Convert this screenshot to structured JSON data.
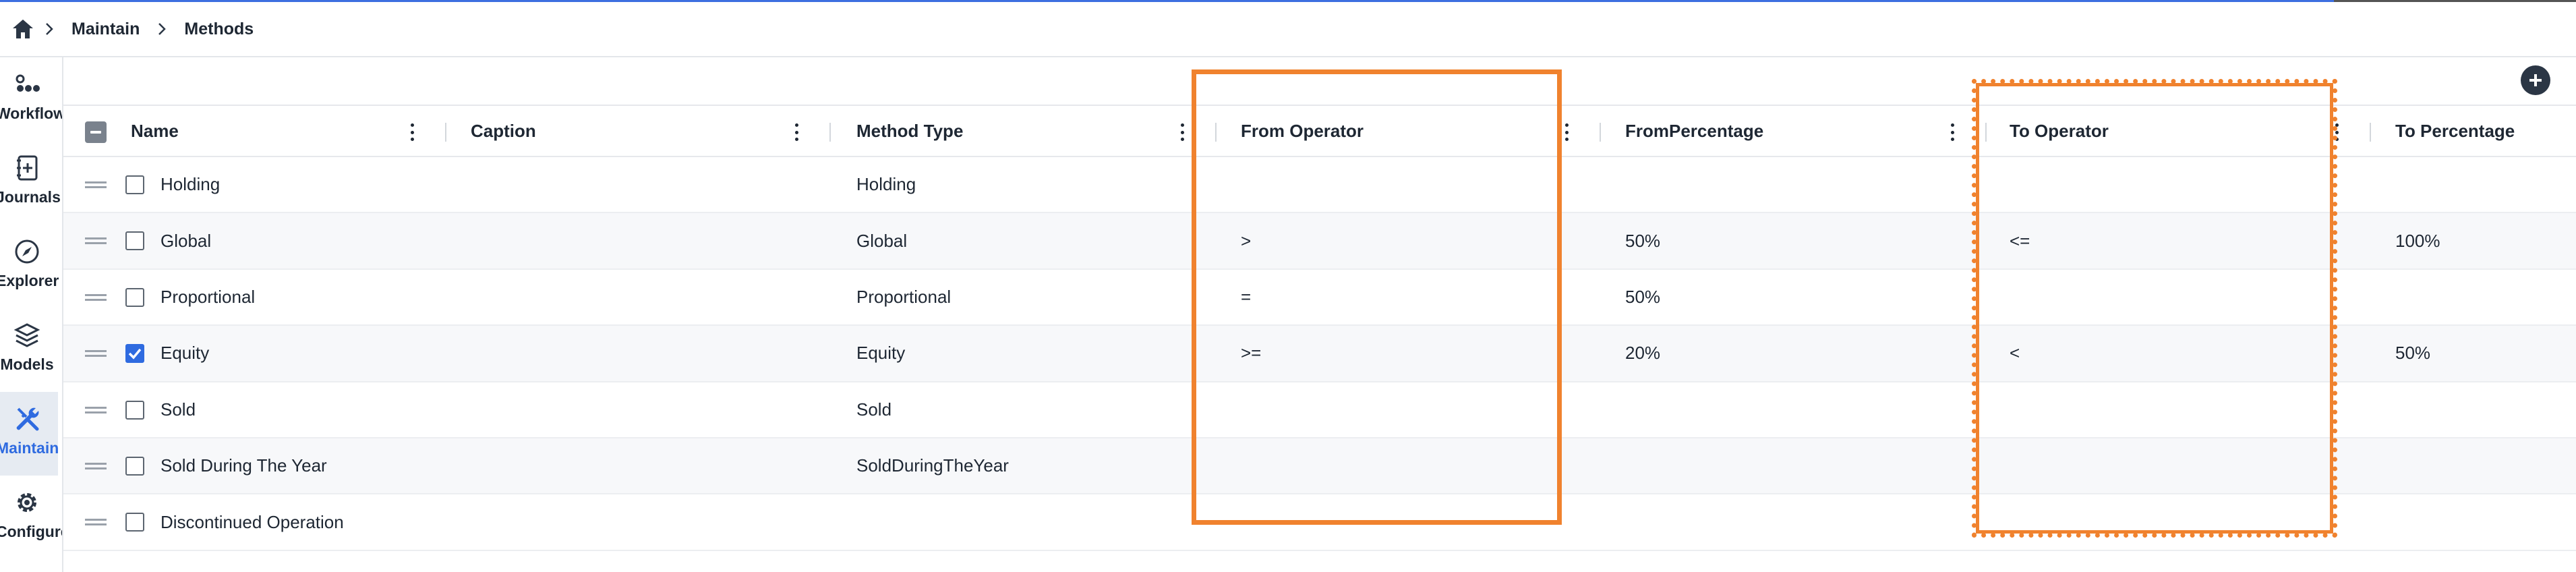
{
  "breadcrumb": [
    "Maintain",
    "Methods"
  ],
  "sidebar": [
    {
      "label": "Workflow",
      "icon": "workflow-icon",
      "active": false
    },
    {
      "label": "Journals",
      "icon": "journals-icon",
      "active": false
    },
    {
      "label": "Explorer",
      "icon": "compass-icon",
      "active": false
    },
    {
      "label": "Models",
      "icon": "layers-icon",
      "active": false
    },
    {
      "label": "Maintain",
      "icon": "tools-icon",
      "active": true
    },
    {
      "label": "Configure",
      "icon": "gear-icon",
      "active": false
    }
  ],
  "toolbar": {
    "add_icon": "plus-circle-icon"
  },
  "columns": [
    "Name",
    "Caption",
    "Method Type",
    "From Operator",
    "FromPercentage",
    "To Operator",
    "To Percentage"
  ],
  "rows": [
    {
      "name": "Holding",
      "caption": "",
      "method_type": "Holding",
      "from_operator": "",
      "from_percentage": "",
      "to_operator": "",
      "to_percentage": "",
      "checked": false
    },
    {
      "name": "Global",
      "caption": "",
      "method_type": "Global",
      "from_operator": ">",
      "from_percentage": "50%",
      "to_operator": "<=",
      "to_percentage": "100%",
      "checked": false
    },
    {
      "name": "Proportional",
      "caption": "",
      "method_type": "Proportional",
      "from_operator": "=",
      "from_percentage": "50%",
      "to_operator": "",
      "to_percentage": "",
      "checked": false
    },
    {
      "name": "Equity",
      "caption": "",
      "method_type": "Equity",
      "from_operator": ">=",
      "from_percentage": "20%",
      "to_operator": "<",
      "to_percentage": "50%",
      "checked": true
    },
    {
      "name": "Sold",
      "caption": "",
      "method_type": "Sold",
      "from_operator": "",
      "from_percentage": "",
      "to_operator": "",
      "to_percentage": "",
      "checked": false
    },
    {
      "name": "Sold During The Year",
      "caption": "",
      "method_type": "SoldDuringTheYear",
      "from_operator": "",
      "from_percentage": "",
      "to_operator": "",
      "to_percentage": "",
      "checked": false
    },
    {
      "name": "Discontinued Operation",
      "caption": "",
      "method_type": "",
      "from_operator": "",
      "from_percentage": "",
      "to_operator": "",
      "to_percentage": "",
      "checked": false
    }
  ],
  "colors": {
    "accent": "#2f6be0",
    "highlight": "#f0822e",
    "text": "#1e2733"
  }
}
